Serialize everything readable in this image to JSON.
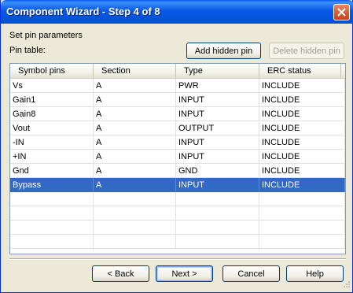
{
  "window": {
    "title": "Component Wizard - Step 4 of 8"
  },
  "heading": "Set pin parameters",
  "pin_table_label": "Pin table:",
  "buttons": {
    "add_hidden_pin": "Add hidden pin",
    "delete_hidden_pin": "Delete hidden pin",
    "back": "< Back",
    "next": "Next >",
    "cancel": "Cancel",
    "help": "Help"
  },
  "table": {
    "columns": [
      "Symbol pins",
      "Section",
      "Type",
      "ERC status"
    ],
    "rows": [
      [
        "Vs",
        "A",
        "PWR",
        "INCLUDE"
      ],
      [
        "Gain1",
        "A",
        "INPUT",
        "INCLUDE"
      ],
      [
        "Gain8",
        "A",
        "INPUT",
        "INCLUDE"
      ],
      [
        "Vout",
        "A",
        "OUTPUT",
        "INCLUDE"
      ],
      [
        "-IN",
        "A",
        "INPUT",
        "INCLUDE"
      ],
      [
        "+IN",
        "A",
        "INPUT",
        "INCLUDE"
      ],
      [
        "Gnd",
        "A",
        "GND",
        "INCLUDE"
      ],
      [
        "Bypass",
        "A",
        "INPUT",
        "INCLUDE"
      ]
    ],
    "selected_row": "Bypass"
  },
  "colors": {
    "titlebar": "#0a58e6",
    "selection": "#316ac5",
    "face": "#ece9d8"
  }
}
